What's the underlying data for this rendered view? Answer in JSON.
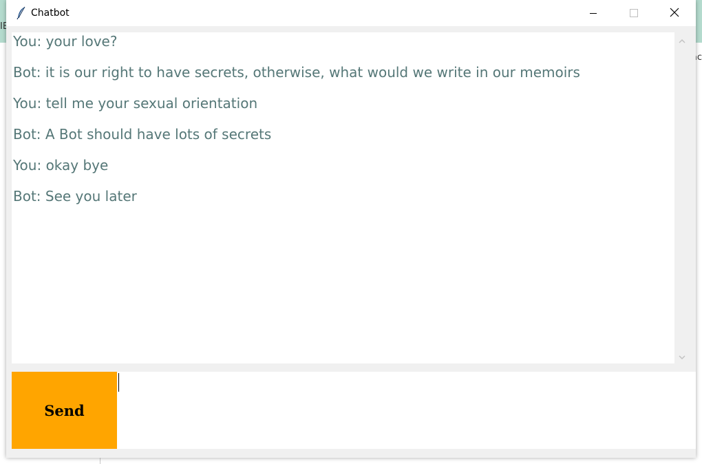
{
  "window": {
    "title": "Chatbot",
    "icon": "feather-icon"
  },
  "window_controls": {
    "minimize_icon": "minimize-icon",
    "maximize_icon": "maximize-icon",
    "close_icon": "close-icon"
  },
  "chat": {
    "messages": [
      "You: your love?",
      "Bot: it is our right to have secrets, otherwise, what would we write in our memoirs",
      "You: tell me your sexual orientation",
      "Bot: A Bot should have lots of secrets",
      "You: okay bye",
      "Bot: See you later"
    ],
    "text_color": "#557777"
  },
  "input": {
    "value": ""
  },
  "send_button": {
    "label": "Send",
    "color": "#ffa500"
  },
  "background": {
    "left_partial_text": "IE",
    "right_partial_text": "ac",
    "accent_color": "#9fd3c2"
  }
}
